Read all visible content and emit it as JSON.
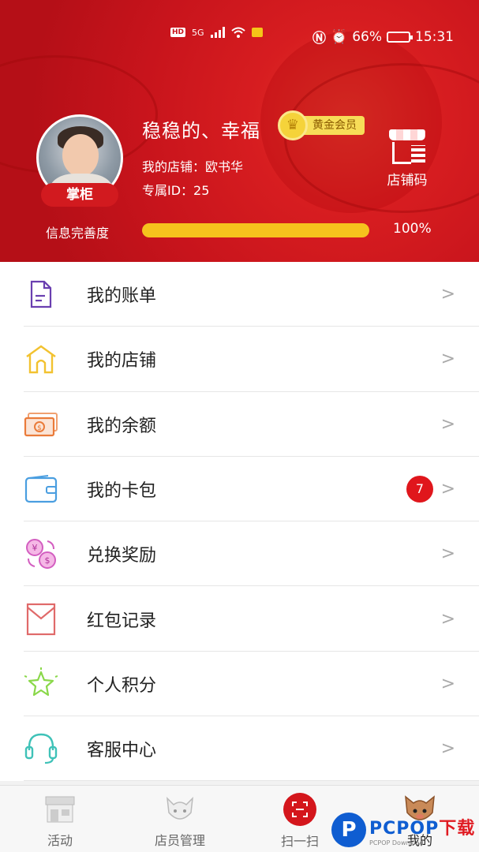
{
  "colors": {
    "header_red": "#c8141c",
    "gold": "#f6c21d",
    "badge_red": "#e0161c",
    "watermark_blue": "#0f5dd1"
  },
  "status_bar": {
    "network": "HD",
    "signal_type": "5G",
    "battery_percent": "66%",
    "battery_level": 0.66,
    "time": "15:31"
  },
  "profile": {
    "name": "稳稳的、幸福",
    "member_level": "黄金会员",
    "role": "掌柜",
    "store_line": "我的店铺：欧书华",
    "id_line": "专属ID：25",
    "store_code_label": "店铺码"
  },
  "completeness": {
    "label": "信息完善度",
    "value_text": "100%",
    "value": 1.0
  },
  "menu": [
    {
      "label": "我的账单",
      "icon": "document-icon"
    },
    {
      "label": "我的店铺",
      "icon": "house-icon"
    },
    {
      "label": "我的余额",
      "icon": "money-icon"
    },
    {
      "label": "我的卡包",
      "icon": "wallet-icon",
      "count": "7"
    },
    {
      "label": "兑换奖励",
      "icon": "exchange-icon"
    },
    {
      "label": "红包记录",
      "icon": "envelope-icon"
    },
    {
      "label": "个人积分",
      "icon": "star-icon"
    },
    {
      "label": "客服中心",
      "icon": "headset-icon"
    }
  ],
  "tabs": [
    {
      "label": "活动",
      "icon": "shop-icon"
    },
    {
      "label": "店员管理",
      "icon": "staff-icon"
    },
    {
      "label": "扫一扫",
      "icon": "scan-icon"
    },
    {
      "label": "我的",
      "icon": "mascot-icon"
    }
  ],
  "watermark": {
    "brand": "PCPOP",
    "brand_suffix": "下载",
    "sub": "PCPOP Download"
  }
}
